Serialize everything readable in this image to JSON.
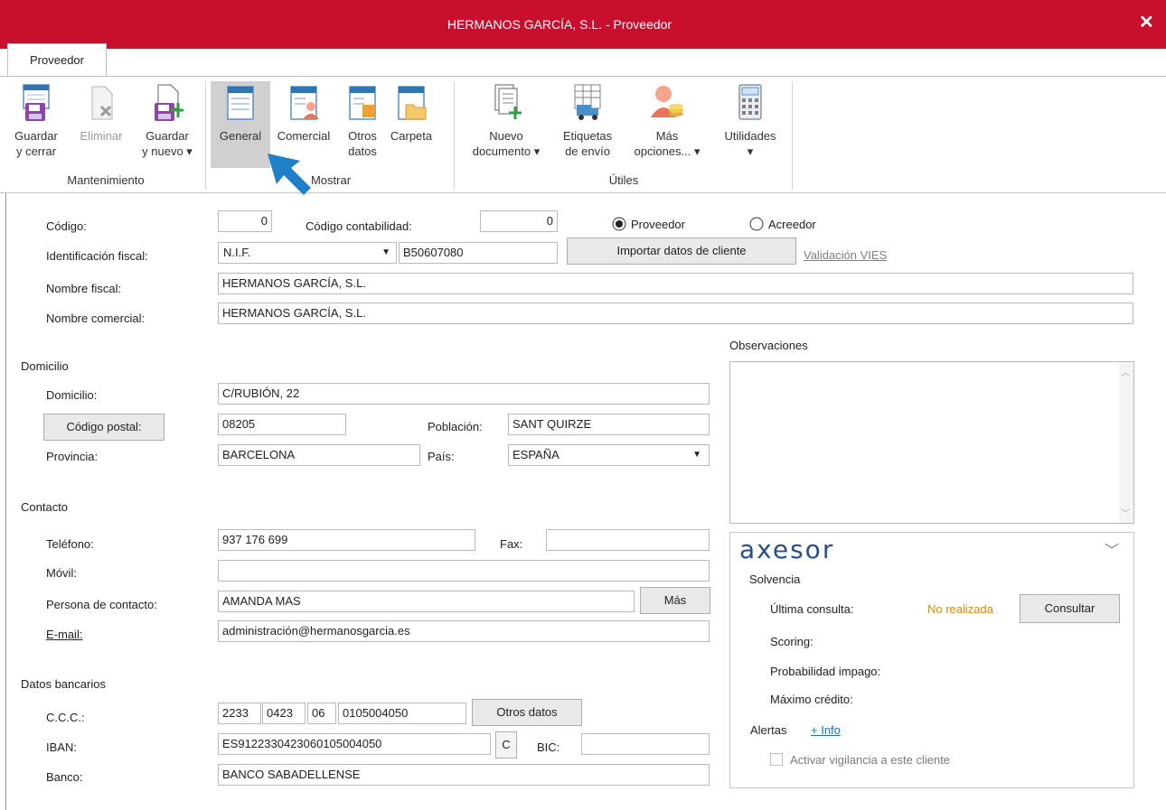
{
  "window": {
    "title": "HERMANOS GARCÍA, S.L. - Proveedor",
    "close": "✕"
  },
  "ribbon": {
    "tab": "Proveedor",
    "groups": {
      "mantenimiento": "Mantenimiento",
      "mostrar": "Mostrar",
      "utiles": "Útiles"
    },
    "buttons": {
      "guardar_cerrar": [
        "Guardar",
        "y cerrar"
      ],
      "eliminar": [
        "Eliminar",
        ""
      ],
      "guardar_nuevo": [
        "Guardar",
        "y nuevo ▾"
      ],
      "general": [
        "General",
        ""
      ],
      "comercial": [
        "Comercial",
        ""
      ],
      "otros_datos": [
        "Otros",
        "datos"
      ],
      "carpeta": [
        "Carpeta",
        ""
      ],
      "nuevo_documento": [
        "Nuevo",
        "documento ▾"
      ],
      "etiquetas": [
        "Etiquetas",
        "de envío"
      ],
      "mas_opciones": [
        "Más",
        "opciones... ▾"
      ],
      "utilidades": [
        "Utilidades",
        "▾"
      ]
    }
  },
  "form": {
    "codigo": {
      "label": "Código:",
      "value": "0"
    },
    "codigo_contabilidad": {
      "label": "Código contabilidad:",
      "value": "0"
    },
    "tipo": {
      "proveedor": "Proveedor",
      "acreedor": "Acreedor",
      "selected": "Proveedor"
    },
    "identificacion": {
      "label": "Identificación fiscal:",
      "type": "N.I.F.",
      "value": "B50607080"
    },
    "importar": "Importar datos de cliente",
    "vies": "Validación VIES",
    "nombre_fiscal": {
      "label": "Nombre fiscal:",
      "value": "HERMANOS GARCÍA, S.L."
    },
    "nombre_comercial": {
      "label": "Nombre comercial:",
      "value": "HERMANOS GARCÍA, S.L."
    },
    "observaciones": "Observaciones",
    "domicilio_section": "Domicilio",
    "domicilio": {
      "label": "Domicilio:",
      "value": "C/RUBIÓN, 22"
    },
    "codigo_postal": {
      "label": "Código postal:",
      "value": "08205"
    },
    "poblacion": {
      "label": "Población:",
      "value": "SANT QUIRZE"
    },
    "provincia": {
      "label": "Provincia:",
      "value": "BARCELONA"
    },
    "pais": {
      "label": "País:",
      "value": "ESPAÑA"
    },
    "contacto_section": "Contacto",
    "telefono": {
      "label": "Teléfono:",
      "value": "937 176 699"
    },
    "fax": {
      "label": "Fax:",
      "value": ""
    },
    "movil": {
      "label": "Móvil:",
      "value": ""
    },
    "persona": {
      "label": "Persona de contacto:",
      "value": "AMANDA MAS"
    },
    "mas": "Más",
    "email": {
      "label": "E-mail:",
      "value": "administración@hermanosgarcia.es"
    },
    "bancarios_section": "Datos bancarios",
    "ccc": {
      "label": "C.C.C.:",
      "entidad": "2233",
      "oficina": "0423",
      "dc": "06",
      "cuenta": "0105004050"
    },
    "otros_datos": "Otros datos",
    "iban": {
      "label": "IBAN:",
      "value": "ES9122330423060105004050",
      "c": "C"
    },
    "bic": {
      "label": "BIC:",
      "value": ""
    },
    "banco": {
      "label": "Banco:",
      "value": "BANCO SABADELLENSE"
    }
  },
  "axesor": {
    "logo": "axesor",
    "solvencia": "Solvencia",
    "ultima_consulta": "Última consulta:",
    "no_realizada": "No realizada",
    "consultar": "Consultar",
    "scoring": "Scoring:",
    "probabilidad": "Probabilidad impago:",
    "maximo": "Máximo crédito:",
    "alertas": "Alertas",
    "info": "+ Info",
    "vigilancia": "Activar vigilancia a este cliente"
  },
  "colors": {
    "titlebar": "#c8102e",
    "accent": "#1b6ec2",
    "warning": "#e08a00",
    "cursor": "#1f7fc8"
  }
}
